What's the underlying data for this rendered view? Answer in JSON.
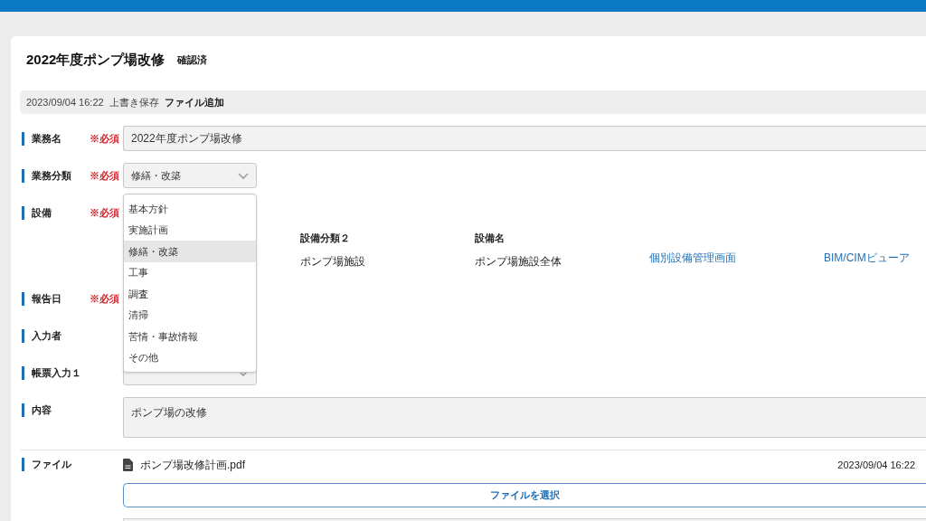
{
  "title": "2022年度ポンプ場改修",
  "status": "確認済",
  "history": {
    "date": "2023/09/04 16:22",
    "action": "上書き保存",
    "detail": "ファイル追加"
  },
  "fields": [
    {
      "kind": "text",
      "label": "業務名",
      "required_mark": "※必須",
      "value": "2022年度ポンプ場改修"
    },
    {
      "kind": "select",
      "label": "業務分類",
      "required_mark": "※必須",
      "value": "修繕・改築",
      "options": [
        {
          "label": "基本方針",
          "selected": false
        },
        {
          "label": "実施計画",
          "selected": false
        },
        {
          "label": "修繕・改築",
          "selected": true
        },
        {
          "label": "工事",
          "selected": false
        },
        {
          "label": "調査",
          "selected": false
        },
        {
          "label": "清掃",
          "selected": false
        },
        {
          "label": "苦情・事故情報",
          "selected": false
        },
        {
          "label": "その他",
          "selected": false
        }
      ]
    },
    {
      "kind": "equipment",
      "label": "設備",
      "required_mark": "※必須",
      "columns": [
        "設備分類２",
        "設備名"
      ],
      "values": [
        "ポンプ場施設",
        "ポンプ場施設全体"
      ],
      "links": [
        "個別設備管理画面",
        "BIM/CIMビューア"
      ]
    },
    {
      "kind": "blank",
      "label": "報告日",
      "required_mark": "※必須"
    },
    {
      "kind": "blank",
      "label": "入力者"
    },
    {
      "kind": "select",
      "label": "帳票入力１"
    },
    {
      "kind": "textarea",
      "label": "内容",
      "value": "ポンプ場の改修"
    },
    {
      "kind": "file",
      "label": "ファイル",
      "files": [
        {
          "name": "ポンプ場改修計画.pdf",
          "date": "2023/09/04 16:22"
        }
      ],
      "button": "ファイルを選択"
    }
  ]
}
